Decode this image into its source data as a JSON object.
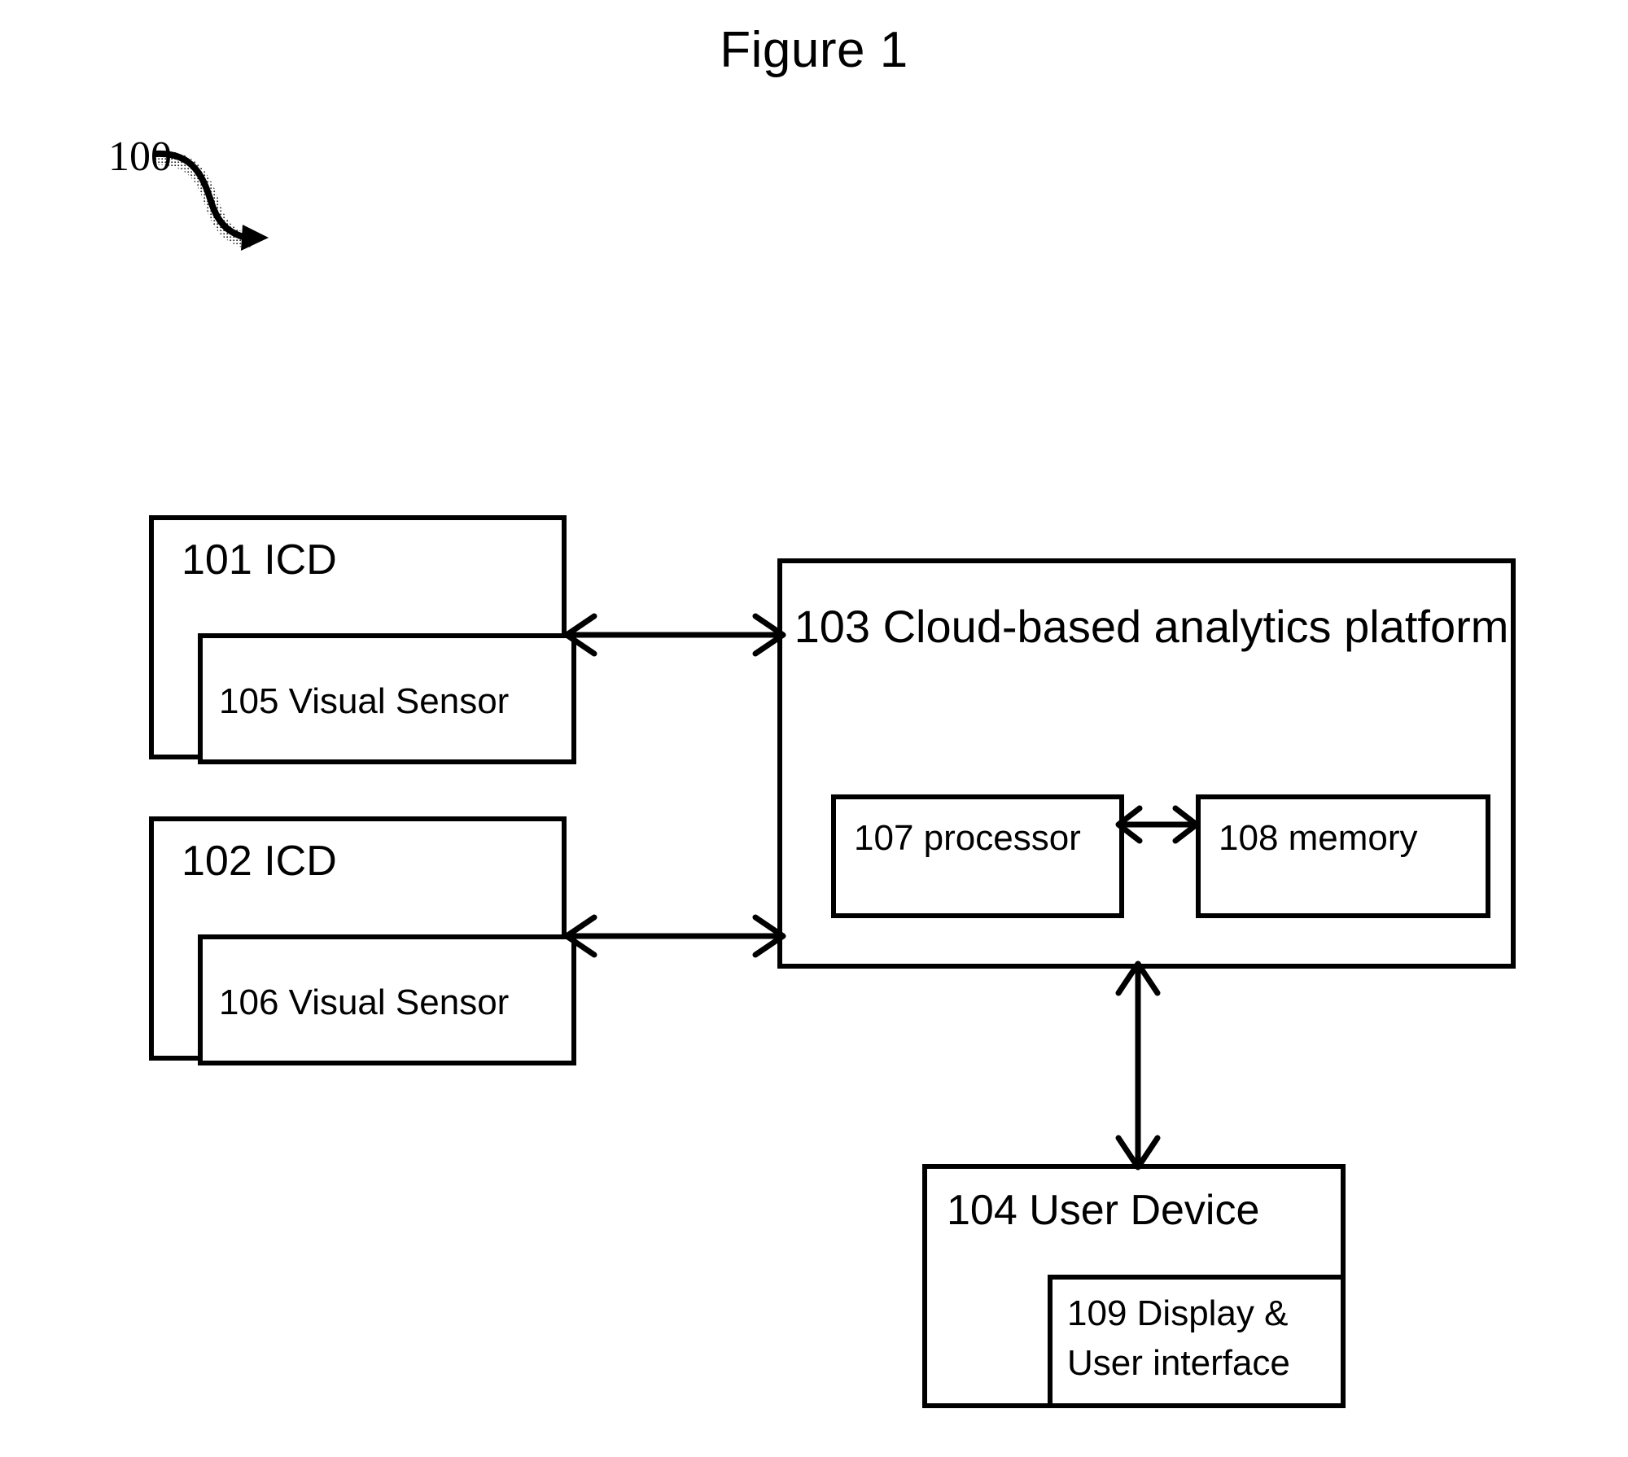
{
  "figure": {
    "title": "Figure 1",
    "reference_numeral": "100"
  },
  "blocks": {
    "icd_101": {
      "title": "101 ICD",
      "sensor": "105 Visual Sensor"
    },
    "icd_102": {
      "title": "102 ICD",
      "sensor": "106 Visual Sensor"
    },
    "cloud_103": {
      "title": "103 Cloud-based analytics platform",
      "processor": "107 processor",
      "memory": "108 memory"
    },
    "user_104": {
      "title": "104 User Device",
      "display": "109 Display & User interface"
    }
  },
  "connectors": [
    {
      "name": "icd-101-to-cloud",
      "type": "double-headed-arrow",
      "orientation": "horizontal"
    },
    {
      "name": "icd-102-to-cloud",
      "type": "double-headed-arrow",
      "orientation": "horizontal"
    },
    {
      "name": "processor-to-memory",
      "type": "double-headed-arrow",
      "orientation": "horizontal"
    },
    {
      "name": "cloud-to-user-device",
      "type": "double-headed-arrow",
      "orientation": "vertical"
    },
    {
      "name": "reference-lead-line",
      "type": "curved-arrow-with-shadow",
      "orientation": "diagonal"
    }
  ],
  "colors": {
    "stroke": "#000000",
    "background": "#ffffff"
  }
}
